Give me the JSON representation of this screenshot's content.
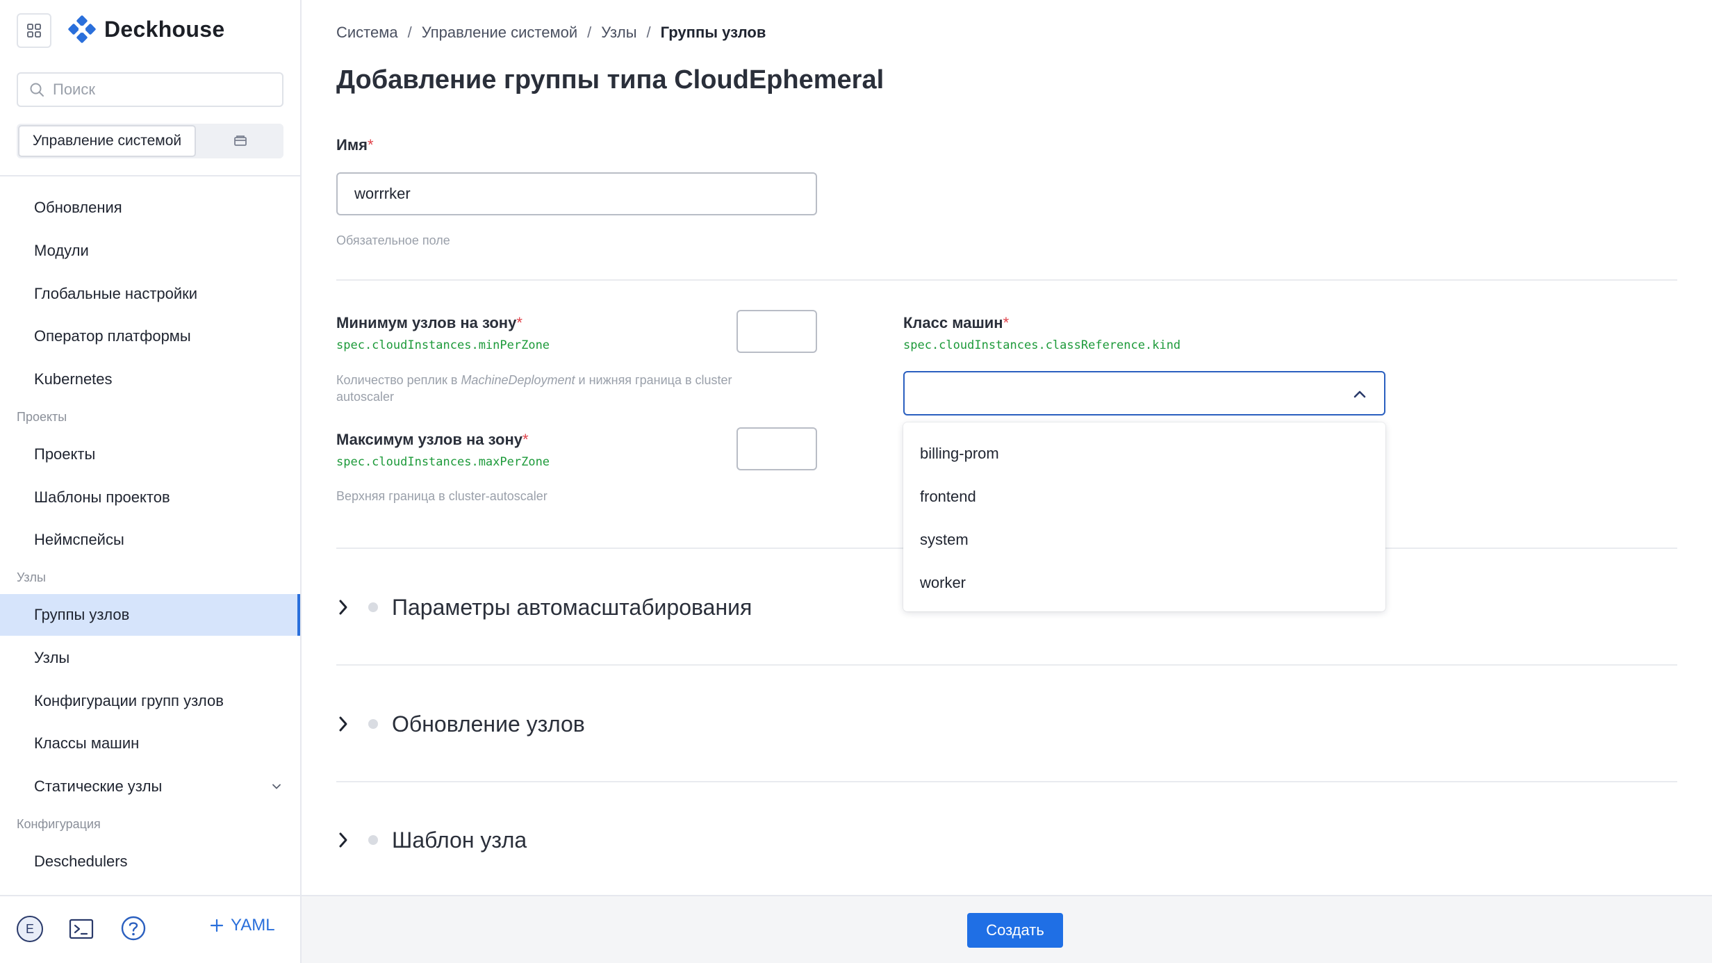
{
  "brand": {
    "name": "Deckhouse"
  },
  "sidebar": {
    "search_placeholder": "Поиск",
    "scope_active": "Управление системой",
    "items": [
      {
        "label": "Обновления"
      },
      {
        "label": "Модули"
      },
      {
        "label": "Глобальные настройки"
      },
      {
        "label": "Оператор платформы"
      },
      {
        "label": "Kubernetes"
      }
    ],
    "section_projects": "Проекты",
    "projects_items": [
      {
        "label": "Проекты"
      },
      {
        "label": "Шаблоны проектов"
      },
      {
        "label": "Неймспейсы"
      }
    ],
    "section_nodes": "Узлы",
    "nodes_items": [
      {
        "label": "Группы узлов",
        "active": true
      },
      {
        "label": "Узлы"
      },
      {
        "label": "Конфигурации групп узлов"
      },
      {
        "label": "Классы машин"
      },
      {
        "label": "Статические узлы"
      }
    ],
    "section_config": "Конфигурация",
    "config_items": [
      {
        "label": "Deschedulers"
      }
    ],
    "footer": {
      "avatar_letter": "E",
      "yaml_label": "YAML"
    }
  },
  "breadcrumb": [
    "Система",
    "Управление системой",
    "Узлы",
    "Группы узлов"
  ],
  "page_title": "Добавление группы типа CloudEphemeral",
  "form": {
    "name": {
      "label": "Имя",
      "value": "worrrker",
      "hint": "Обязательное поле"
    },
    "min_per_zone": {
      "label": "Минимум узлов на зону",
      "path": "spec.cloudInstances.minPerZone",
      "hint_prefix": "Количество реплик в ",
      "hint_em": "MachineDeployment",
      "hint_suffix": " и нижняя граница в cluster autoscaler",
      "value": ""
    },
    "max_per_zone": {
      "label": "Максимум узлов на зону",
      "path": "spec.cloudInstances.maxPerZone",
      "hint": "Верхняя граница в cluster-autoscaler",
      "value": ""
    },
    "machine_class": {
      "label": "Класс машин",
      "path": "spec.cloudInstances.classReference.kind",
      "value": "",
      "options": [
        "billing-prom",
        "frontend",
        "system",
        "worker"
      ]
    }
  },
  "sections": [
    {
      "title": "Параметры автомасштабирования"
    },
    {
      "title": "Обновление узлов"
    },
    {
      "title": "Шаблон узла"
    }
  ],
  "actions": {
    "create_label": "Создать"
  },
  "colors": {
    "accent": "#1f6fe5",
    "required": "#e0434b",
    "path": "#1d9a3a",
    "active_nav": "#d6e4fb"
  }
}
